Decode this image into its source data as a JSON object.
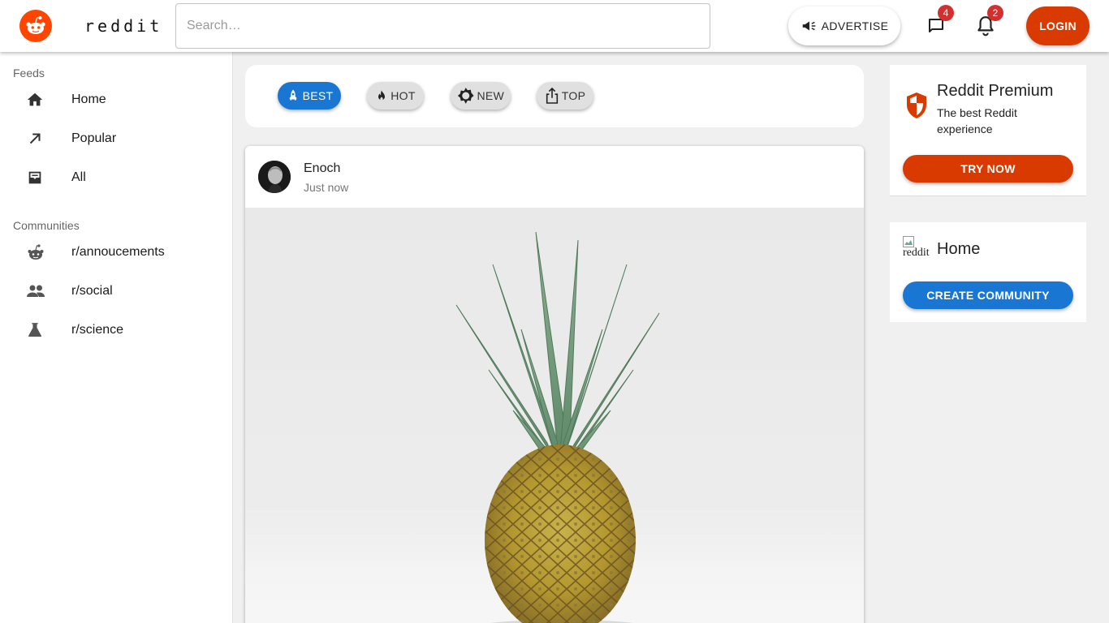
{
  "header": {
    "wordmark": "reddit",
    "search_placeholder": "Search…",
    "advertise_label": "ADVERTISE",
    "chat_badge": "4",
    "notification_badge": "2",
    "login_label": "LOGIN"
  },
  "sidebar": {
    "feeds_heading": "Feeds",
    "feeds": [
      {
        "label": "Home",
        "icon": "home-icon"
      },
      {
        "label": "Popular",
        "icon": "arrow-up-right-icon"
      },
      {
        "label": "All",
        "icon": "inbox-icon"
      }
    ],
    "communities_heading": "Communities",
    "communities": [
      {
        "label": "r/annoucements",
        "icon": "reddit-alien-icon"
      },
      {
        "label": "r/social",
        "icon": "people-icon"
      },
      {
        "label": "r/science",
        "icon": "flask-icon"
      }
    ]
  },
  "filters": [
    {
      "label": "BEST",
      "icon": "rocket-icon",
      "active": true
    },
    {
      "label": "HOT",
      "icon": "flame-icon",
      "active": false
    },
    {
      "label": "NEW",
      "icon": "sun-icon",
      "active": false
    },
    {
      "label": "TOP",
      "icon": "share-up-icon",
      "active": false
    }
  ],
  "post": {
    "author": "Enoch",
    "time": "Just now",
    "image_subject": "pineapple"
  },
  "premium": {
    "title": "Reddit Premium",
    "description": "The best Reddit experience",
    "button_label": "TRY NOW"
  },
  "home_card": {
    "image_alt": "reddit",
    "title": "Home",
    "button_label": "CREATE COMMUNITY"
  },
  "colors": {
    "brand": "#ff4500",
    "login": "#d93a00",
    "primary": "#1976d2",
    "badge": "#d32f2f"
  }
}
